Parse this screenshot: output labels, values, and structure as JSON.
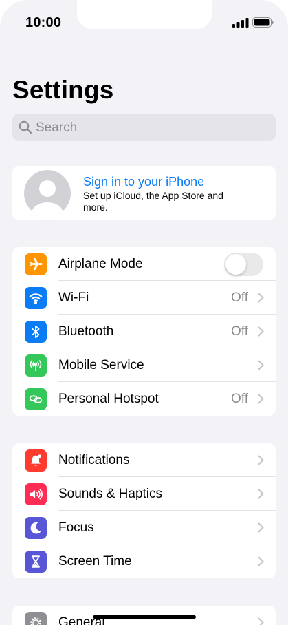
{
  "status_bar": {
    "time": "10:00"
  },
  "page_title": "Settings",
  "search": {
    "placeholder": "Search"
  },
  "profile": {
    "title": "Sign in to your iPhone",
    "subtitle": "Set up iCloud, the App Store and more."
  },
  "connectivity": [
    {
      "label": "Airplane Mode",
      "icon": "airplane-icon",
      "color": "#ff9500",
      "toggle": false
    },
    {
      "label": "Wi-Fi",
      "icon": "wifi-icon",
      "color": "#0a7cf5",
      "value": "Off"
    },
    {
      "label": "Bluetooth",
      "icon": "bluetooth-icon",
      "color": "#0a7cf5",
      "value": "Off"
    },
    {
      "label": "Mobile Service",
      "icon": "antenna-icon",
      "color": "#34c759",
      "value": ""
    },
    {
      "label": "Personal Hotspot",
      "icon": "link-icon",
      "color": "#34c759",
      "value": "Off"
    }
  ],
  "notifications_group": [
    {
      "label": "Notifications",
      "icon": "bell-icon",
      "color": "#ff3b30"
    },
    {
      "label": "Sounds & Haptics",
      "icon": "speaker-icon",
      "color": "#ff2d55"
    },
    {
      "label": "Focus",
      "icon": "moon-icon",
      "color": "#5856d6"
    },
    {
      "label": "Screen Time",
      "icon": "hourglass-icon",
      "color": "#5856d6"
    }
  ],
  "general_group": [
    {
      "label": "General",
      "icon": "gear-icon",
      "color": "#8e8e93"
    }
  ]
}
